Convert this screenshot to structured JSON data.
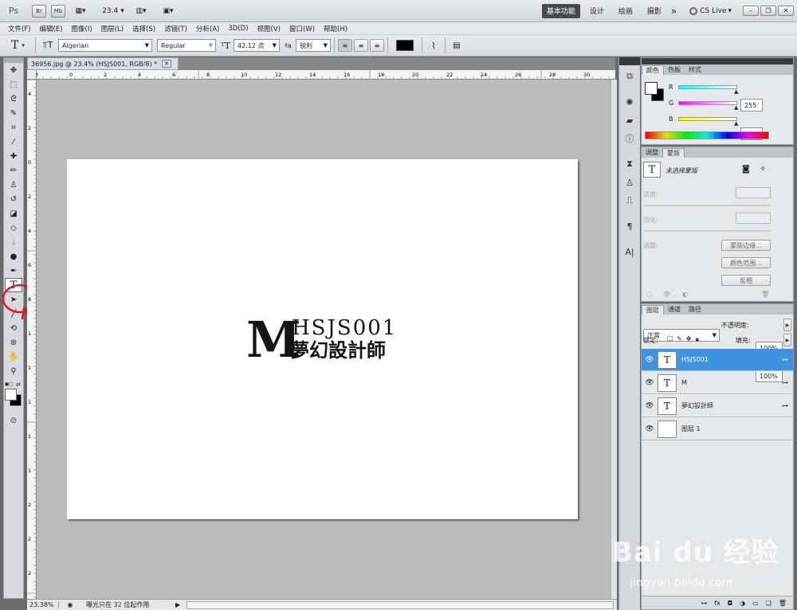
{
  "titlebar": {
    "app_logo": "Ps",
    "br": "Br",
    "mb": "Mb",
    "zoom_value": "23.4",
    "workspaces": [
      "基本功能",
      "设计",
      "绘画",
      "摄影"
    ],
    "more": "»",
    "cslive": "CS Live"
  },
  "menu": [
    "文件(F)",
    "编辑(E)",
    "图像(I)",
    "图层(L)",
    "选择(S)",
    "滤镜(T)",
    "分析(A)",
    "3D(D)",
    "视图(V)",
    "窗口(W)",
    "帮助(H)"
  ],
  "options": {
    "tool_glyph": "T",
    "font_family": "Algerian",
    "font_style": "Regular",
    "font_size": "42.12 点",
    "aa_label": "ªa",
    "antialias": "锐利",
    "color": "#000000"
  },
  "document": {
    "tab_title": "36956.jpg @ 23.4% (HSJS001, RGB/8) *",
    "big_letter": "M",
    "line1": "HSJS001",
    "line2": "夢幻設計師",
    "ruler_top": [
      "2",
      "0",
      "2",
      "4",
      "6",
      "8",
      "10",
      "12",
      "14",
      "16",
      "18",
      "20",
      "22",
      "24",
      "26",
      "28",
      "30"
    ],
    "ruler_left": [
      "4",
      "2",
      "0",
      "2",
      "4",
      "6",
      "8",
      "1",
      "1",
      "1",
      "1",
      "1",
      "2",
      "2",
      "2"
    ]
  },
  "status": {
    "zoom": "23.38%",
    "info": "曝光只在 32 位起作用"
  },
  "color_panel": {
    "tabs": [
      "颜色",
      "色板",
      "样式"
    ],
    "channels": [
      {
        "label": "R",
        "value": "255",
        "grad": "#00ffff,#ff0000"
      },
      {
        "label": "G",
        "value": "255",
        "grad": "#ff00ff,#00ff00"
      },
      {
        "label": "B",
        "value": "255",
        "grad": "#ffff00,#0000ff"
      }
    ]
  },
  "mask_panel": {
    "tabs": [
      "调整",
      "蒙版"
    ],
    "title": "未选择蒙版",
    "density_label": "浓度:",
    "feather_label": "羽化:",
    "refine_label": "调整:",
    "btn_edge": "蒙版边缘...",
    "btn_range": "颜色范围...",
    "btn_invert": "反相"
  },
  "layers_panel": {
    "tabs": [
      "图层",
      "通道",
      "路径"
    ],
    "blend_mode": "正常",
    "opacity_label": "不透明度:",
    "opacity": "100%",
    "lock_label": "锁定:",
    "fill_label": "填充:",
    "fill": "100%",
    "layers": [
      {
        "name": "HSJS001",
        "thumb": "T",
        "selected": true
      },
      {
        "name": "M",
        "thumb": "T",
        "selected": false
      },
      {
        "name": "夢幻設計師",
        "thumb": "T",
        "selected": false
      },
      {
        "name": "图层 1",
        "thumb": "",
        "selected": false
      }
    ]
  },
  "watermark": {
    "brand": "Bai du 经验",
    "url": "jingyan.baidu.com"
  }
}
